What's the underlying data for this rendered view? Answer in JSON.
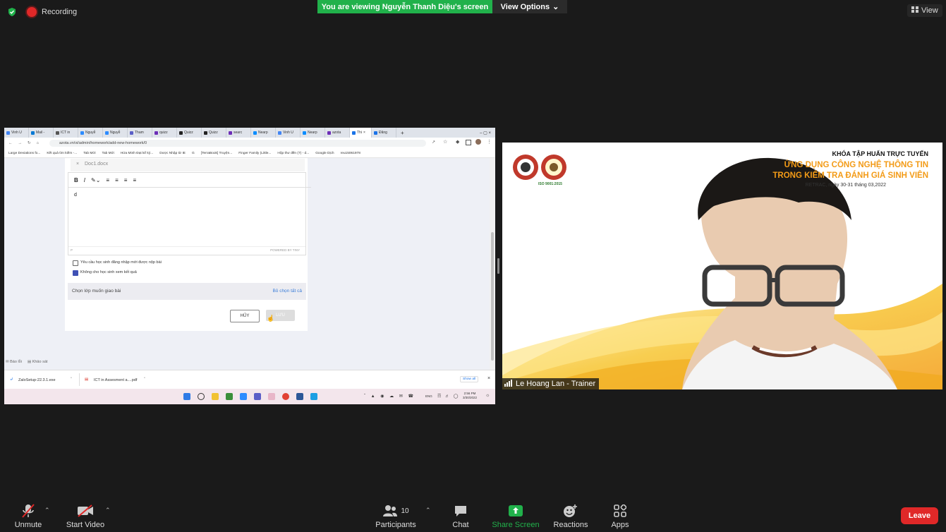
{
  "zoom": {
    "recording_label": "Recording",
    "banner_text": "You are viewing Nguyễn Thanh Diệu's screen",
    "view_options_label": "View Options",
    "view_button_label": "View",
    "participant_name": "Le Hoang Lan - Trainer",
    "participants_count": "10",
    "colors": {
      "banner": "#21b14b",
      "leave": "#e02828",
      "background": "#1a1a1a",
      "share_screen": "#21b14b"
    },
    "toolbar": {
      "unmute": "Unmute",
      "start_video": "Start Video",
      "participants": "Participants",
      "chat": "Chat",
      "share_screen": "Share Screen",
      "reactions": "Reactions",
      "apps": "Apps",
      "leave": "Leave"
    }
  },
  "shared_screen": {
    "tabs": [
      {
        "label": "Vinh U",
        "color": "#4285f4"
      },
      {
        "label": "Mail -",
        "color": "#0078d4"
      },
      {
        "label": "ICT in",
        "color": "#555"
      },
      {
        "label": "Nguyễ",
        "color": "#2d8cff"
      },
      {
        "label": "Nguyễ",
        "color": "#2d8cff"
      },
      {
        "label": "Tham",
        "color": "#5b5fc7"
      },
      {
        "label": "quizz",
        "color": "#6d2eb7"
      },
      {
        "label": "Quizz",
        "color": "#222"
      },
      {
        "label": "Quizz",
        "color": "#222"
      },
      {
        "label": "searc",
        "color": "#6d2eb7"
      },
      {
        "label": "Nearp",
        "color": "#0a8dff"
      },
      {
        "label": "Vinh U",
        "color": "#4285f4"
      },
      {
        "label": "Nearp",
        "color": "#0a8dff"
      },
      {
        "label": "azota",
        "color": "#6d2eb7"
      },
      {
        "label": "Thi",
        "color": "#1a73e8",
        "active": true
      },
      {
        "label": "Đăng",
        "color": "#1a73e8"
      }
    ],
    "url": "azota.vn/vi/admin/homework/add-new-homework/0",
    "bookmarks": [
      "Large Deviations fo...",
      "Kết quả tìm kiếm -...",
      "Tab Mới",
      "Tab Mới",
      "Hứa Minh Đạt kể kỷ...",
      "Dược Nhập từ IE",
      "G",
      "[TerraBook] Truyện...",
      "Finger Family (Little...",
      "Hộp thư đến (7) - d...",
      "Google Dịch",
      "reu15061978"
    ],
    "file_name": "Doc1.docx",
    "editor_text": "d",
    "editor_path": "P",
    "editor_powered": "POWERED BY TINY",
    "options": [
      {
        "label": "Yêu cầu học sinh đăng nhập mới được nộp bài",
        "checked": false
      },
      {
        "label": "Không cho học sinh xem kết quả",
        "checked": true
      }
    ],
    "class_prompt": "Chọn lớp muốn giao bài",
    "class_clear": "Bỏ chọn tất cả",
    "cancel_label": "HỦY",
    "save_label": "LƯU",
    "footer_report": "Báo lỗi",
    "footer_survey": "Khảo sát",
    "downloads": [
      {
        "label": "ZaloSetup-22.3.1.exe"
      },
      {
        "label": "ICT in Assesment a....pdf"
      }
    ],
    "show_all": "Show all",
    "taskbar_lang": "ENG",
    "taskbar_time": "2:56 PM",
    "taskbar_date": "3/30/2022"
  },
  "video_slide": {
    "title_line1": "KHÓA TẬP HUẤN TRỰC TUYẾN",
    "title_line2": "ỨNG DỤNG CÔNG NGHỆ THÔNG TIN",
    "title_line3": "TRONG KIỂM TRA ĐÁNH GIÁ SINH VIÊN",
    "title_line4": "RETRAC, ngày 30-31 tháng 03,2022",
    "iso": "ISO 9001:2015"
  }
}
